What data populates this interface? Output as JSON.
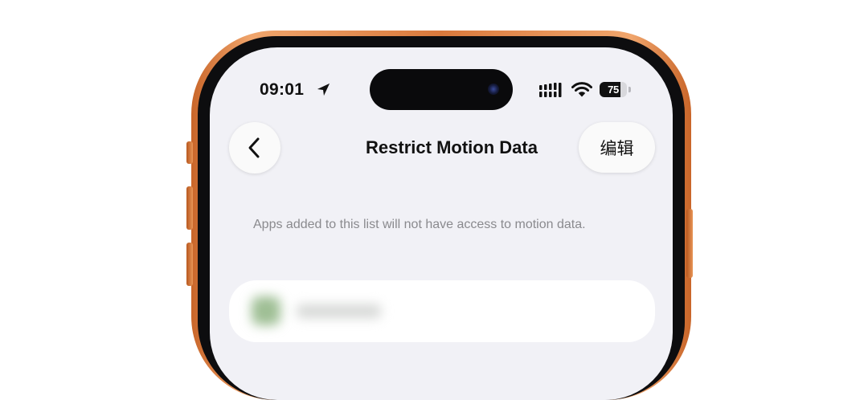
{
  "status_bar": {
    "time": "09:01",
    "battery_level": "75",
    "battery_fraction": 0.75,
    "icons": [
      "location-arrow-icon",
      "cellular-signal-icon",
      "wifi-icon",
      "battery-icon"
    ]
  },
  "nav_bar": {
    "back_icon": "chevron-left-icon",
    "title": "Restrict Motion Data",
    "edit_label": "编辑"
  },
  "content": {
    "description": "Apps added to this list will not have access to motion data.",
    "list_items": [
      {
        "icon": "app-icon",
        "label": ""
      }
    ]
  },
  "colors": {
    "frame": "#e08a48",
    "screen_background": "#f1f1f6",
    "card_background": "#ffffff",
    "secondary_text": "#8a8a8e"
  }
}
